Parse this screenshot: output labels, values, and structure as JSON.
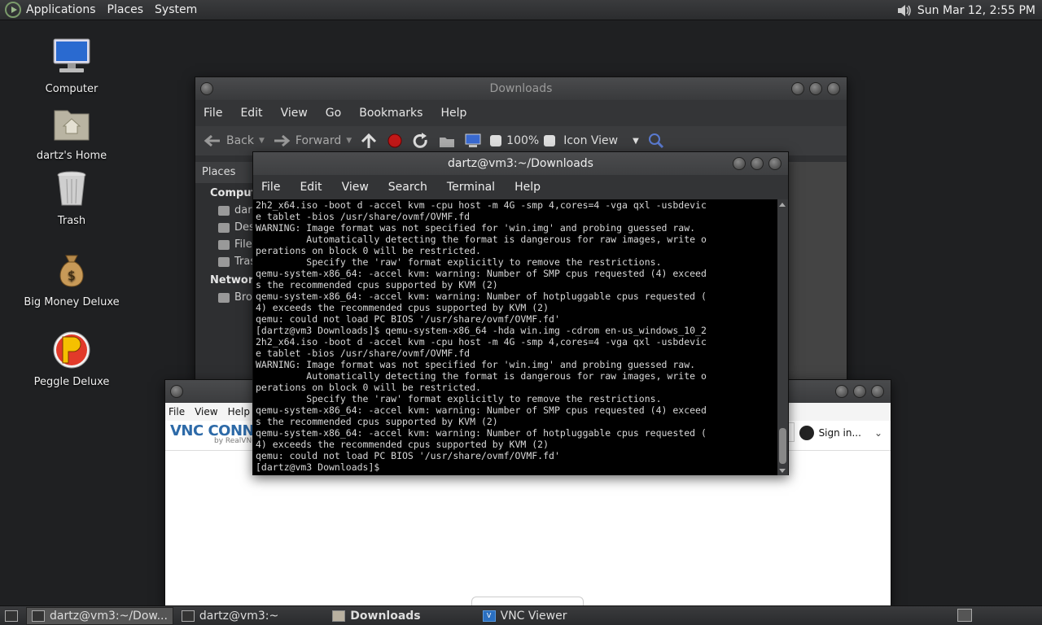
{
  "top_panel": {
    "menus": [
      "Applications",
      "Places",
      "System"
    ],
    "clock": "Sun Mar 12,  2:55 PM",
    "tray_icon": "volume-icon"
  },
  "desktop": {
    "icons": [
      {
        "label": "Computer",
        "icon": "computer-icon"
      },
      {
        "label": "dartz's Home",
        "icon": "home-folder-icon"
      },
      {
        "label": "Trash",
        "icon": "trash-icon"
      },
      {
        "label": "Big Money Deluxe",
        "icon": "money-bag-icon"
      },
      {
        "label": "Peggle Deluxe",
        "icon": "peggle-icon"
      }
    ]
  },
  "downloads_window": {
    "title": "Downloads",
    "menus": [
      "File",
      "Edit",
      "View",
      "Go",
      "Bookmarks",
      "Help"
    ],
    "toolbar": {
      "back": "Back",
      "forward": "Forward",
      "zoom": "100%",
      "view_mode": "Icon View"
    },
    "sidebar": {
      "header": "Places",
      "section_computer": "Computer",
      "items": [
        "dartz",
        "Desktop",
        "File System",
        "Trash"
      ],
      "section_network": "Network",
      "network_items": [
        "Browse Network"
      ]
    }
  },
  "vnc_window": {
    "menus": [
      "File",
      "View",
      "Help"
    ],
    "brand": "VNC CONNECT",
    "brand_sub": "by RealVNC",
    "sign_in": "Sign in..."
  },
  "terminal_window": {
    "title": "dartz@vm3:~/Downloads",
    "menus": [
      "File",
      "Edit",
      "View",
      "Search",
      "Terminal",
      "Help"
    ],
    "lines": [
      "2h2_x64.iso -boot d -accel kvm -cpu host -m 4G -smp 4,cores=4 -vga qxl -usbdevic",
      "e tablet -bios /usr/share/ovmf/OVMF.fd",
      "WARNING: Image format was not specified for 'win.img' and probing guessed raw.",
      "         Automatically detecting the format is dangerous for raw images, write o",
      "perations on block 0 will be restricted.",
      "         Specify the 'raw' format explicitly to remove the restrictions.",
      "qemu-system-x86_64: -accel kvm: warning: Number of SMP cpus requested (4) exceed",
      "s the recommended cpus supported by KVM (2)",
      "qemu-system-x86_64: -accel kvm: warning: Number of hotpluggable cpus requested (",
      "4) exceeds the recommended cpus supported by KVM (2)",
      "qemu: could not load PC BIOS '/usr/share/ovmf/OVMF.fd'",
      "[dartz@vm3 Downloads]$ qemu-system-x86_64 -hda win.img -cdrom en-us_windows_10_2",
      "2h2_x64.iso -boot d -accel kvm -cpu host -m 4G -smp 4,cores=4 -vga qxl -usbdevic",
      "e tablet -bios /usr/share/ovmf/OVMF.fd",
      "WARNING: Image format was not specified for 'win.img' and probing guessed raw.",
      "         Automatically detecting the format is dangerous for raw images, write o",
      "perations on block 0 will be restricted.",
      "         Specify the 'raw' format explicitly to remove the restrictions.",
      "qemu-system-x86_64: -accel kvm: warning: Number of SMP cpus requested (4) exceed",
      "s the recommended cpus supported by KVM (2)",
      "qemu-system-x86_64: -accel kvm: warning: Number of hotpluggable cpus requested (",
      "4) exceeds the recommended cpus supported by KVM (2)",
      "qemu: could not load PC BIOS '/usr/share/ovmf/OVMF.fd'",
      "[dartz@vm3 Downloads]$ "
    ]
  },
  "taskbar": {
    "items": [
      {
        "label": "dartz@vm3:~/Dow...",
        "icon": "terminal-icon",
        "active": true
      },
      {
        "label": "dartz@vm3:~",
        "icon": "terminal-icon",
        "active": false
      },
      {
        "label": "Downloads",
        "icon": "folder-icon",
        "active": false
      },
      {
        "label": "VNC Viewer",
        "icon": "vnc-icon",
        "active": false
      }
    ]
  }
}
